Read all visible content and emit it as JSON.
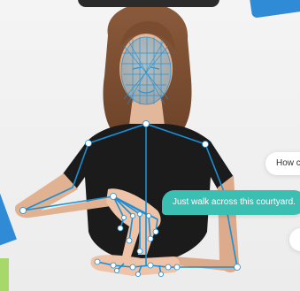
{
  "chat": {
    "teal_message": "Just walk across this courtyard.",
    "white_message": "How c"
  },
  "colors": {
    "skeleton": "#1a8fd6",
    "joint": "#ffffff",
    "teal_bubble": "#3bbfb3",
    "accent_blue": "#2f8bd6",
    "accent_green": "#a6d96a"
  },
  "icons": [
    "face-mesh-icon",
    "pose-skeleton-icon"
  ]
}
